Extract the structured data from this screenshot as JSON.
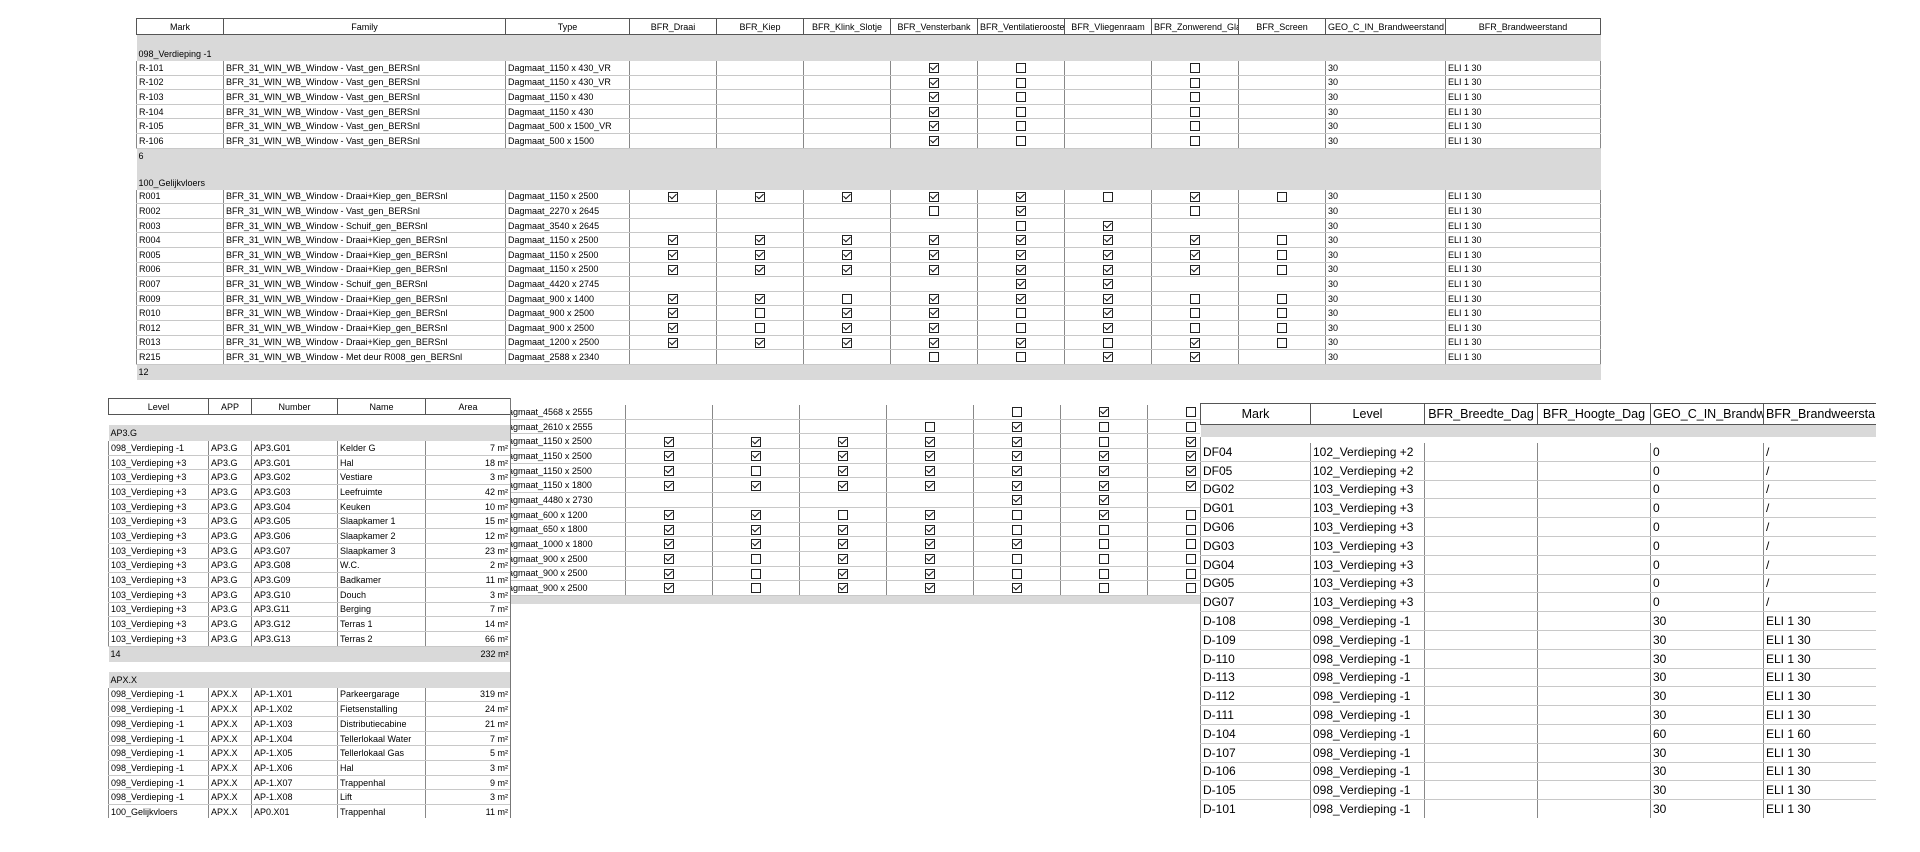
{
  "window_schedule": {
    "headers": [
      "Mark",
      "Family",
      "Type",
      "BFR_Draai",
      "BFR_Kiep",
      "BFR_Klink_Slotje",
      "BFR_Vensterbank",
      "BFR_Ventilatierooster",
      "BFR_Vliegenraam",
      "BFR_Zonwerend_Glas",
      "BFR_Screen",
      "GEO_C_IN_Brandweerstand",
      "BFR_Brandweerstand"
    ],
    "groups": [
      {
        "title": "098_Verdieping -1",
        "count": "6",
        "rows": [
          {
            "mark": "R-101",
            "family": "BFR_31_WIN_WB_Window - Vast_gen_BERSnl",
            "type": "Dagmaat_1150 x 430_VR",
            "checks": [
              null,
              null,
              null,
              true,
              false,
              null,
              false,
              null
            ],
            "geo": "30",
            "brand": "ELI 1 30"
          },
          {
            "mark": "R-102",
            "family": "BFR_31_WIN_WB_Window - Vast_gen_BERSnl",
            "type": "Dagmaat_1150 x 430_VR",
            "checks": [
              null,
              null,
              null,
              true,
              false,
              null,
              false,
              null
            ],
            "geo": "30",
            "brand": "ELI 1 30"
          },
          {
            "mark": "R-103",
            "family": "BFR_31_WIN_WB_Window - Vast_gen_BERSnl",
            "type": "Dagmaat_1150 x 430",
            "checks": [
              null,
              null,
              null,
              true,
              false,
              null,
              false,
              null
            ],
            "geo": "30",
            "brand": "ELI 1 30"
          },
          {
            "mark": "R-104",
            "family": "BFR_31_WIN_WB_Window - Vast_gen_BERSnl",
            "type": "Dagmaat_1150 x 430",
            "checks": [
              null,
              null,
              null,
              true,
              false,
              null,
              false,
              null
            ],
            "geo": "30",
            "brand": "ELI 1 30"
          },
          {
            "mark": "R-105",
            "family": "BFR_31_WIN_WB_Window - Vast_gen_BERSnl",
            "type": "Dagmaat_500 x 1500_VR",
            "checks": [
              null,
              null,
              null,
              true,
              false,
              null,
              false,
              null
            ],
            "geo": "30",
            "brand": "ELI 1 30"
          },
          {
            "mark": "R-106",
            "family": "BFR_31_WIN_WB_Window - Vast_gen_BERSnl",
            "type": "Dagmaat_500 x 1500",
            "checks": [
              null,
              null,
              null,
              true,
              false,
              null,
              false,
              null
            ],
            "geo": "30",
            "brand": "ELI 1 30"
          }
        ]
      },
      {
        "title": "100_Gelijkvloers",
        "count": "12",
        "rows": [
          {
            "mark": "R001",
            "family": "BFR_31_WIN_WB_Window - Draai+Kiep_gen_BERSnl",
            "type": "Dagmaat_1150 x 2500",
            "checks": [
              true,
              true,
              true,
              true,
              true,
              false,
              true,
              false
            ],
            "geo": "30",
            "brand": "ELI 1 30"
          },
          {
            "mark": "R002",
            "family": "BFR_31_WIN_WB_Window - Vast_gen_BERSnl",
            "type": "Dagmaat_2270 x 2645",
            "checks": [
              null,
              null,
              null,
              false,
              true,
              null,
              false,
              null
            ],
            "geo": "30",
            "brand": "ELI 1 30"
          },
          {
            "mark": "R003",
            "family": "BFR_31_WIN_WB_Window - Schuif_gen_BERSnl",
            "type": "Dagmaat_3540 x 2645",
            "checks": [
              null,
              null,
              null,
              null,
              false,
              true,
              null,
              null
            ],
            "geo": "30",
            "brand": "ELI 1 30"
          },
          {
            "mark": "R004",
            "family": "BFR_31_WIN_WB_Window - Draai+Kiep_gen_BERSnl",
            "type": "Dagmaat_1150 x 2500",
            "checks": [
              true,
              true,
              true,
              true,
              true,
              true,
              true,
              false
            ],
            "geo": "30",
            "brand": "ELI 1 30"
          },
          {
            "mark": "R005",
            "family": "BFR_31_WIN_WB_Window - Draai+Kiep_gen_BERSnl",
            "type": "Dagmaat_1150 x 2500",
            "checks": [
              true,
              true,
              true,
              true,
              true,
              true,
              true,
              false
            ],
            "geo": "30",
            "brand": "ELI 1 30"
          },
          {
            "mark": "R006",
            "family": "BFR_31_WIN_WB_Window - Draai+Kiep_gen_BERSnl",
            "type": "Dagmaat_1150 x 2500",
            "checks": [
              true,
              true,
              true,
              true,
              true,
              true,
              true,
              false
            ],
            "geo": "30",
            "brand": "ELI 1 30"
          },
          {
            "mark": "R007",
            "family": "BFR_31_WIN_WB_Window - Schuif_gen_BERSnl",
            "type": "Dagmaat_4420 x 2745",
            "checks": [
              null,
              null,
              null,
              null,
              true,
              true,
              null,
              null
            ],
            "geo": "30",
            "brand": "ELI 1 30"
          },
          {
            "mark": "R009",
            "family": "BFR_31_WIN_WB_Window - Draai+Kiep_gen_BERSnl",
            "type": "Dagmaat_900 x 1400",
            "checks": [
              true,
              true,
              false,
              true,
              true,
              true,
              false,
              false
            ],
            "geo": "30",
            "brand": "ELI 1 30"
          },
          {
            "mark": "R010",
            "family": "BFR_31_WIN_WB_Window - Draai+Kiep_gen_BERSnl",
            "type": "Dagmaat_900 x 2500",
            "checks": [
              true,
              false,
              true,
              true,
              false,
              true,
              false,
              false
            ],
            "geo": "30",
            "brand": "ELI 1 30"
          },
          {
            "mark": "R012",
            "family": "BFR_31_WIN_WB_Window - Draai+Kiep_gen_BERSnl",
            "type": "Dagmaat_900 x 2500",
            "checks": [
              true,
              false,
              true,
              true,
              false,
              true,
              false,
              false
            ],
            "geo": "30",
            "brand": "ELI 1 30"
          },
          {
            "mark": "R013",
            "family": "BFR_31_WIN_WB_Window - Draai+Kiep_gen_BERSnl",
            "type": "Dagmaat_1200 x 2500",
            "checks": [
              true,
              true,
              true,
              true,
              true,
              false,
              true,
              false
            ],
            "geo": "30",
            "brand": "ELI 1 30"
          },
          {
            "mark": "R215",
            "family": "BFR_31_WIN_WB_Window - Met deur R008_gen_BERSnl",
            "type": "Dagmaat_2588 x 2340",
            "checks": [
              null,
              null,
              null,
              false,
              false,
              true,
              true,
              null
            ],
            "geo": "30",
            "brand": "ELI 1 30"
          }
        ]
      }
    ]
  },
  "window_schedule_lower": {
    "rows": [
      {
        "type": "agmaat_4568 x 2555",
        "checks": [
          null,
          null,
          null,
          null,
          false,
          true,
          false
        ]
      },
      {
        "type": "agmaat_2610 x 2555",
        "checks": [
          null,
          null,
          null,
          false,
          true,
          false,
          false
        ]
      },
      {
        "type": "agmaat_1150 x 2500",
        "checks": [
          true,
          true,
          true,
          true,
          true,
          false,
          true
        ]
      },
      {
        "type": "agmaat_1150 x 2500",
        "checks": [
          true,
          true,
          true,
          true,
          true,
          true,
          true
        ]
      },
      {
        "type": "agmaat_1150 x 2500",
        "checks": [
          true,
          false,
          true,
          true,
          true,
          true,
          true
        ]
      },
      {
        "type": "agmaat_1150 x 1800",
        "checks": [
          true,
          true,
          true,
          true,
          true,
          true,
          true
        ]
      },
      {
        "type": "agmaat_4480 x 2730",
        "checks": [
          null,
          null,
          null,
          null,
          true,
          true,
          null
        ]
      },
      {
        "type": "agmaat_600 x 1200",
        "checks": [
          true,
          true,
          false,
          true,
          false,
          true,
          false
        ]
      },
      {
        "type": "agmaat_650 x 1800",
        "checks": [
          true,
          true,
          true,
          true,
          false,
          false,
          false
        ]
      },
      {
        "type": "agmaat_1000 x 1800",
        "checks": [
          true,
          true,
          true,
          true,
          true,
          false,
          false
        ]
      },
      {
        "type": "agmaat_900 x 2500",
        "checks": [
          true,
          false,
          true,
          true,
          false,
          false,
          false
        ]
      },
      {
        "type": "agmaat_900 x 2500",
        "checks": [
          true,
          false,
          true,
          true,
          false,
          false,
          false
        ]
      },
      {
        "type": "agmaat_900 x 2500",
        "checks": [
          true,
          false,
          true,
          true,
          true,
          false,
          false
        ]
      }
    ]
  },
  "room_schedule": {
    "headers": [
      "Level",
      "APP",
      "Number",
      "Name",
      "Area"
    ],
    "groups": [
      {
        "title": "AP3.G",
        "count": "14",
        "total": "232 m²",
        "rows": [
          {
            "level": "098_Verdieping -1",
            "app": "AP3.G",
            "number": "AP3.G01",
            "name": "Kelder G",
            "area": "7 m²"
          },
          {
            "level": "103_Verdieping +3",
            "app": "AP3.G",
            "number": "AP3.G01",
            "name": "Hal",
            "area": "18 m²"
          },
          {
            "level": "103_Verdieping +3",
            "app": "AP3.G",
            "number": "AP3.G02",
            "name": "Vestiare",
            "area": "3 m²"
          },
          {
            "level": "103_Verdieping +3",
            "app": "AP3.G",
            "number": "AP3.G03",
            "name": "Leefruimte",
            "area": "42 m²"
          },
          {
            "level": "103_Verdieping +3",
            "app": "AP3.G",
            "number": "AP3.G04",
            "name": "Keuken",
            "area": "10 m²"
          },
          {
            "level": "103_Verdieping +3",
            "app": "AP3.G",
            "number": "AP3.G05",
            "name": "Slaapkamer 1",
            "area": "15 m²"
          },
          {
            "level": "103_Verdieping +3",
            "app": "AP3.G",
            "number": "AP3.G06",
            "name": "Slaapkamer 2",
            "area": "12 m²"
          },
          {
            "level": "103_Verdieping +3",
            "app": "AP3.G",
            "number": "AP3.G07",
            "name": "Slaapkamer 3",
            "area": "23 m²"
          },
          {
            "level": "103_Verdieping +3",
            "app": "AP3.G",
            "number": "AP3.G08",
            "name": "W.C.",
            "area": "2 m²"
          },
          {
            "level": "103_Verdieping +3",
            "app": "AP3.G",
            "number": "AP3.G09",
            "name": "Badkamer",
            "area": "11 m²"
          },
          {
            "level": "103_Verdieping +3",
            "app": "AP3.G",
            "number": "AP3.G10",
            "name": "Douch",
            "area": "3 m²"
          },
          {
            "level": "103_Verdieping +3",
            "app": "AP3.G",
            "number": "AP3.G11",
            "name": "Berging",
            "area": "7 m²"
          },
          {
            "level": "103_Verdieping +3",
            "app": "AP3.G",
            "number": "AP3.G12",
            "name": "Terras 1",
            "area": "14 m²"
          },
          {
            "level": "103_Verdieping +3",
            "app": "AP3.G",
            "number": "AP3.G13",
            "name": "Terras 2",
            "area": "66 m²"
          }
        ]
      },
      {
        "title": "APX.X",
        "rows": [
          {
            "level": "098_Verdieping -1",
            "app": "APX.X",
            "number": "AP-1.X01",
            "name": "Parkeergarage",
            "area": "319 m²"
          },
          {
            "level": "098_Verdieping -1",
            "app": "APX.X",
            "number": "AP-1.X02",
            "name": "Fietsenstalling",
            "area": "24 m²"
          },
          {
            "level": "098_Verdieping -1",
            "app": "APX.X",
            "number": "AP-1.X03",
            "name": "Distributiecabine",
            "area": "21 m²"
          },
          {
            "level": "098_Verdieping -1",
            "app": "APX.X",
            "number": "AP-1.X04",
            "name": "Tellerlokaal Water",
            "area": "7 m²"
          },
          {
            "level": "098_Verdieping -1",
            "app": "APX.X",
            "number": "AP-1.X05",
            "name": "Tellerlokaal Gas",
            "area": "5 m²"
          },
          {
            "level": "098_Verdieping -1",
            "app": "APX.X",
            "number": "AP-1.X06",
            "name": "Hal",
            "area": "3 m²"
          },
          {
            "level": "098_Verdieping -1",
            "app": "APX.X",
            "number": "AP-1.X07",
            "name": "Trappenhal",
            "area": "9 m²"
          },
          {
            "level": "098_Verdieping -1",
            "app": "APX.X",
            "number": "AP-1.X08",
            "name": "Lift",
            "area": "3 m²"
          },
          {
            "level": "100_Gelijkvloers",
            "app": "APX.X",
            "number": "AP0.X01",
            "name": "Trappenhal",
            "area": "11 m²"
          }
        ]
      }
    ]
  },
  "door_schedule": {
    "headers": [
      "Mark",
      "Level",
      "BFR_Breedte_Dag",
      "BFR_Hoogte_Dag",
      "GEO_C_IN_Brandw",
      "BFR_Brandweersta"
    ],
    "rows": [
      {
        "mark": "DF04",
        "level": "102_Verdieping +2",
        "breedte": "",
        "hoogte": "",
        "geo": "0",
        "brand": "/"
      },
      {
        "mark": "DF05",
        "level": "102_Verdieping +2",
        "breedte": "",
        "hoogte": "",
        "geo": "0",
        "brand": "/"
      },
      {
        "mark": "DG02",
        "level": "103_Verdieping +3",
        "breedte": "",
        "hoogte": "",
        "geo": "0",
        "brand": "/"
      },
      {
        "mark": "DG01",
        "level": "103_Verdieping +3",
        "breedte": "",
        "hoogte": "",
        "geo": "0",
        "brand": "/"
      },
      {
        "mark": "DG06",
        "level": "103_Verdieping +3",
        "breedte": "",
        "hoogte": "",
        "geo": "0",
        "brand": "/"
      },
      {
        "mark": "DG03",
        "level": "103_Verdieping +3",
        "breedte": "",
        "hoogte": "",
        "geo": "0",
        "brand": "/"
      },
      {
        "mark": "DG04",
        "level": "103_Verdieping +3",
        "breedte": "",
        "hoogte": "",
        "geo": "0",
        "brand": "/"
      },
      {
        "mark": "DG05",
        "level": "103_Verdieping +3",
        "breedte": "",
        "hoogte": "",
        "geo": "0",
        "brand": "/"
      },
      {
        "mark": "DG07",
        "level": "103_Verdieping +3",
        "breedte": "",
        "hoogte": "",
        "geo": "0",
        "brand": "/"
      },
      {
        "mark": "D-108",
        "level": "098_Verdieping -1",
        "breedte": "",
        "hoogte": "",
        "geo": "30",
        "brand": "ELI 1 30"
      },
      {
        "mark": "D-109",
        "level": "098_Verdieping -1",
        "breedte": "",
        "hoogte": "",
        "geo": "30",
        "brand": "ELI 1 30"
      },
      {
        "mark": "D-110",
        "level": "098_Verdieping -1",
        "breedte": "",
        "hoogte": "",
        "geo": "30",
        "brand": "ELI 1 30"
      },
      {
        "mark": "D-113",
        "level": "098_Verdieping -1",
        "breedte": "",
        "hoogte": "",
        "geo": "30",
        "brand": "ELI 1 30"
      },
      {
        "mark": "D-112",
        "level": "098_Verdieping -1",
        "breedte": "",
        "hoogte": "",
        "geo": "30",
        "brand": "ELI 1 30"
      },
      {
        "mark": "D-111",
        "level": "098_Verdieping -1",
        "breedte": "",
        "hoogte": "",
        "geo": "30",
        "brand": "ELI 1 30"
      },
      {
        "mark": "D-104",
        "level": "098_Verdieping -1",
        "breedte": "",
        "hoogte": "",
        "geo": "60",
        "brand": "ELI 1 60"
      },
      {
        "mark": "D-107",
        "level": "098_Verdieping -1",
        "breedte": "",
        "hoogte": "",
        "geo": "30",
        "brand": "ELI 1 30"
      },
      {
        "mark": "D-106",
        "level": "098_Verdieping -1",
        "breedte": "",
        "hoogte": "",
        "geo": "30",
        "brand": "ELI 1 30"
      },
      {
        "mark": "D-105",
        "level": "098_Verdieping -1",
        "breedte": "",
        "hoogte": "",
        "geo": "30",
        "brand": "ELI 1 30"
      },
      {
        "mark": "D-101",
        "level": "098_Verdieping -1",
        "breedte": "",
        "hoogte": "",
        "geo": "30",
        "brand": "ELI 1 30"
      }
    ]
  }
}
